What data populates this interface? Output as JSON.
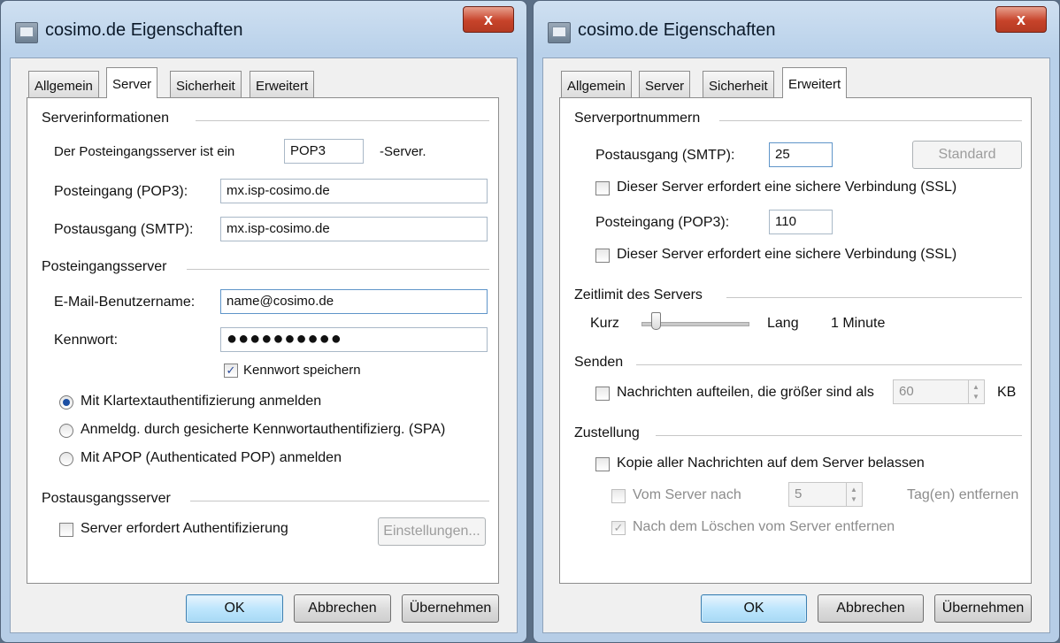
{
  "dialog1": {
    "title": "cosimo.de Eigenschaften",
    "close_label": "x",
    "tabs": [
      "Allgemein",
      "Server",
      "Sicherheit",
      "Erweitert"
    ],
    "server_info": {
      "heading": "Serverinformationen",
      "incoming_type_prefix": "Der Posteingangsserver ist ein",
      "incoming_type": "POP3",
      "incoming_type_suffix": "-Server.",
      "pop3_label": "Posteingang (POP3):",
      "pop3_value": "mx.isp-cosimo.de",
      "smtp_label": "Postausgang (SMTP):",
      "smtp_value": "mx.isp-cosimo.de"
    },
    "incoming_server": {
      "heading": "Posteingangsserver",
      "username_label": "E-Mail-Benutzername:",
      "username_value": "name@cosimo.de",
      "password_label": "Kennwort:",
      "password_value": "●●●●●●●●●●",
      "save_password_label": "Kennwort speichern",
      "save_password_checked": true,
      "auth_options": [
        "Mit Klartextauthentifizierung anmelden",
        "Anmeldg. durch gesicherte Kennwortauthentifizierg. (SPA)",
        "Mit APOP (Authenticated POP) anmelden"
      ],
      "auth_selected": 0
    },
    "outgoing_server": {
      "heading": "Postausgangsserver",
      "auth_required_label": "Server erfordert Authentifizierung",
      "settings_button": "Einstellungen..."
    },
    "buttons": {
      "ok": "OK",
      "cancel": "Abbrechen",
      "apply": "Übernehmen"
    }
  },
  "dialog2": {
    "title": "cosimo.de Eigenschaften",
    "close_label": "x",
    "tabs": [
      "Allgemein",
      "Server",
      "Sicherheit",
      "Erweitert"
    ],
    "ports": {
      "heading": "Serverportnummern",
      "smtp_label": "Postausgang (SMTP):",
      "smtp_value": "25",
      "default_button": "Standard",
      "smtp_ssl_label": "Dieser Server erfordert eine sichere Verbindung (SSL)",
      "pop3_label": "Posteingang (POP3):",
      "pop3_value": "110",
      "pop3_ssl_label": "Dieser Server erfordert eine sichere Verbindung (SSL)"
    },
    "timeout": {
      "heading": "Zeitlimit des Servers",
      "short_label": "Kurz",
      "long_label": "Lang",
      "value_label": "1 Minute",
      "level": 0.1
    },
    "send": {
      "heading": "Senden",
      "split_label": "Nachrichten aufteilen, die größer sind als",
      "split_value": "60",
      "unit": "KB"
    },
    "delivery": {
      "heading": "Zustellung",
      "keep_copy_label": "Kopie aller Nachrichten auf dem Server belassen",
      "remove_after_prefix": "Vom Server nach",
      "remove_after_value": "5",
      "remove_after_suffix": "Tag(en) entfernen",
      "remove_on_delete_label": "Nach dem Löschen vom Server entfernen"
    },
    "buttons": {
      "ok": "OK",
      "cancel": "Abbrechen",
      "apply": "Übernehmen"
    }
  }
}
